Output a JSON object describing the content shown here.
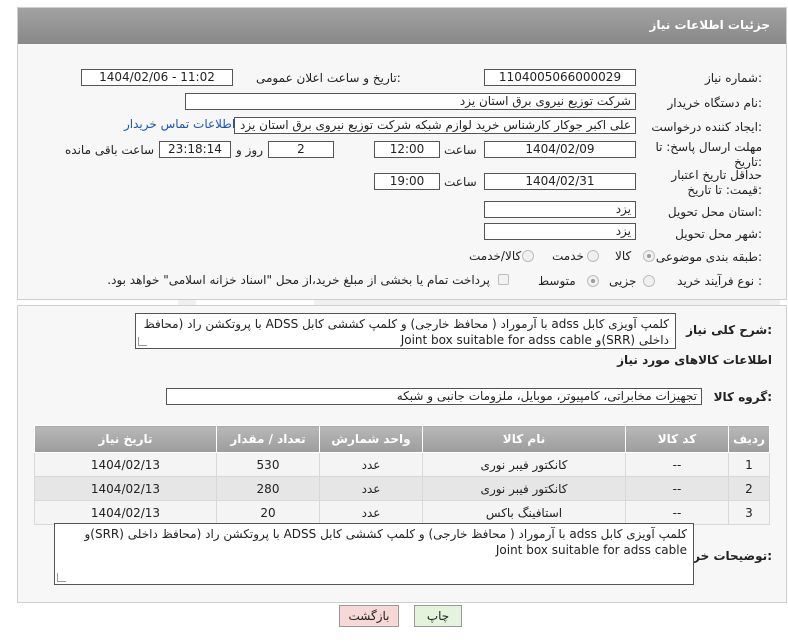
{
  "header": {
    "title": "جزئیات اطلاعات نیاز"
  },
  "fields": {
    "need_number_label": "شماره نیاز:",
    "need_number": "1104005066000029",
    "announce_label": "تاریخ و ساعت اعلان عمومی:",
    "announce_value": "1404/02/06 - 11:02",
    "buyer_org_label": "نام دستگاه خریدار:",
    "buyer_org": "شرکت توزیع نیروی برق استان یزد",
    "creator_label": "ایجاد کننده درخواست:",
    "creator": "علی اکبر جوکار  کارشناس خرید لوازم شبکه  شرکت توزیع نیروی برق استان یزد",
    "contact_link": "اطلاعات تماس خریدار",
    "deadline_label": "مهلت ارسال پاسخ: تا تاریخ:",
    "deadline_date": "1404/02/09",
    "time_label": "ساعت",
    "deadline_time": "12:00",
    "days_value": "2",
    "days_label": "روز و",
    "remaining_time": "23:18:14",
    "remaining_label": "ساعت باقی مانده",
    "price_validity_label": "حداقل تاریخ اعتبار قیمت: تا تاریخ:",
    "price_validity_date": "1404/02/31",
    "price_validity_time": "19:00",
    "province_label": "استان محل تحویل:",
    "province": "یزد",
    "city_label": "شهر محل تحویل:",
    "city": "یزد",
    "category_label": "طبقه بندی موضوعی:",
    "category_options": [
      "کالا",
      "خدمت",
      "کالا/خدمت"
    ],
    "process_label": "نوع فرآیند خرید :",
    "process_options": [
      "جزیی",
      "متوسط"
    ],
    "payment_note": "پرداخت تمام یا بخشی از مبلغ خرید،از محل \"اسناد خزانه اسلامی\" خواهد بود."
  },
  "summary": {
    "label": "شرح کلی نیاز:",
    "text": "کلمپ آویزی کابل adss  با آرموراد ( محافظ خارجی) و کلمپ کششی کابل ADSS  با پروتکشن راد (محافظ داخلی (SRR)و Joint box suitable for adss cable"
  },
  "goods": {
    "section_title": "اطلاعات کالاهای مورد نیاز",
    "group_label": "گروه کالا:",
    "group_value": "تجهیزات مخابراتی، کامپیوتر، موبایل، ملزومات جانبی و شبکه",
    "columns": [
      "ردیف",
      "کد کالا",
      "نام کالا",
      "واحد شمارش",
      "تعداد / مقدار",
      "تاریخ نیاز"
    ],
    "rows": [
      [
        "1",
        "--",
        "کانکتور فیبر نوری",
        "عدد",
        "530",
        "1404/02/13"
      ],
      [
        "2",
        "--",
        "کانکتور فیبر نوری",
        "عدد",
        "280",
        "1404/02/13"
      ],
      [
        "3",
        "--",
        "استافینگ باکس",
        "عدد",
        "20",
        "1404/02/13"
      ]
    ]
  },
  "buyer_notes": {
    "label": "توضیحات خریدار:",
    "text": "کلمپ آویزی کابل adss  با آرموراد ( محافظ خارجی) و کلمپ کششی کابل ADSS  با پروتکشن راد (محافظ داخلی (SRR)و Joint box suitable for adss cable"
  },
  "buttons": {
    "print": "چاپ",
    "back": "بازگشت"
  },
  "colors": {
    "header": "#999999",
    "link": "#1a56b8",
    "back_button": "#f8d7d7",
    "print_button": "#e3f3dc"
  }
}
